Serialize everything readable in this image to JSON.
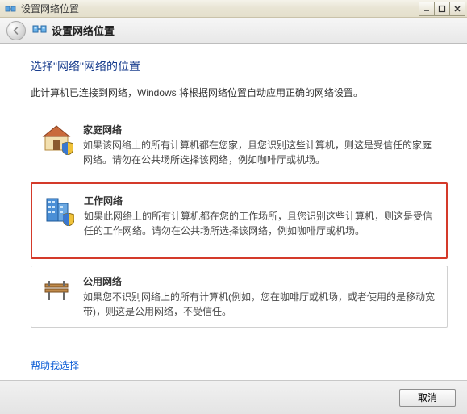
{
  "titlebar": {
    "title": "设置网络位置"
  },
  "nav": {
    "title": "设置网络位置"
  },
  "heading": "选择\"网络\"网络的位置",
  "subtext": "此计算机已连接到网络，Windows 将根据网络位置自动应用正确的网络设置。",
  "options": {
    "home": {
      "title": "家庭网络",
      "desc": "如果该网络上的所有计算机都在您家，且您识别这些计算机，则这是受信任的家庭网络。请勿在公共场所选择该网络，例如咖啡厅或机场。"
    },
    "work": {
      "title": "工作网络",
      "desc": "如果此网络上的所有计算机都在您的工作场所，且您识别这些计算机，则这是受信任的工作网络。请勿在公共场所选择该网络，例如咖啡厅或机场。"
    },
    "public": {
      "title": "公用网络",
      "desc": "如果您不识别网络上的所有计算机(例如，您在咖啡厅或机场，或者使用的是移动宽带)，则这是公用网络，不受信任。"
    }
  },
  "help_link": "帮助我选择",
  "footer": {
    "cancel": "取消"
  }
}
